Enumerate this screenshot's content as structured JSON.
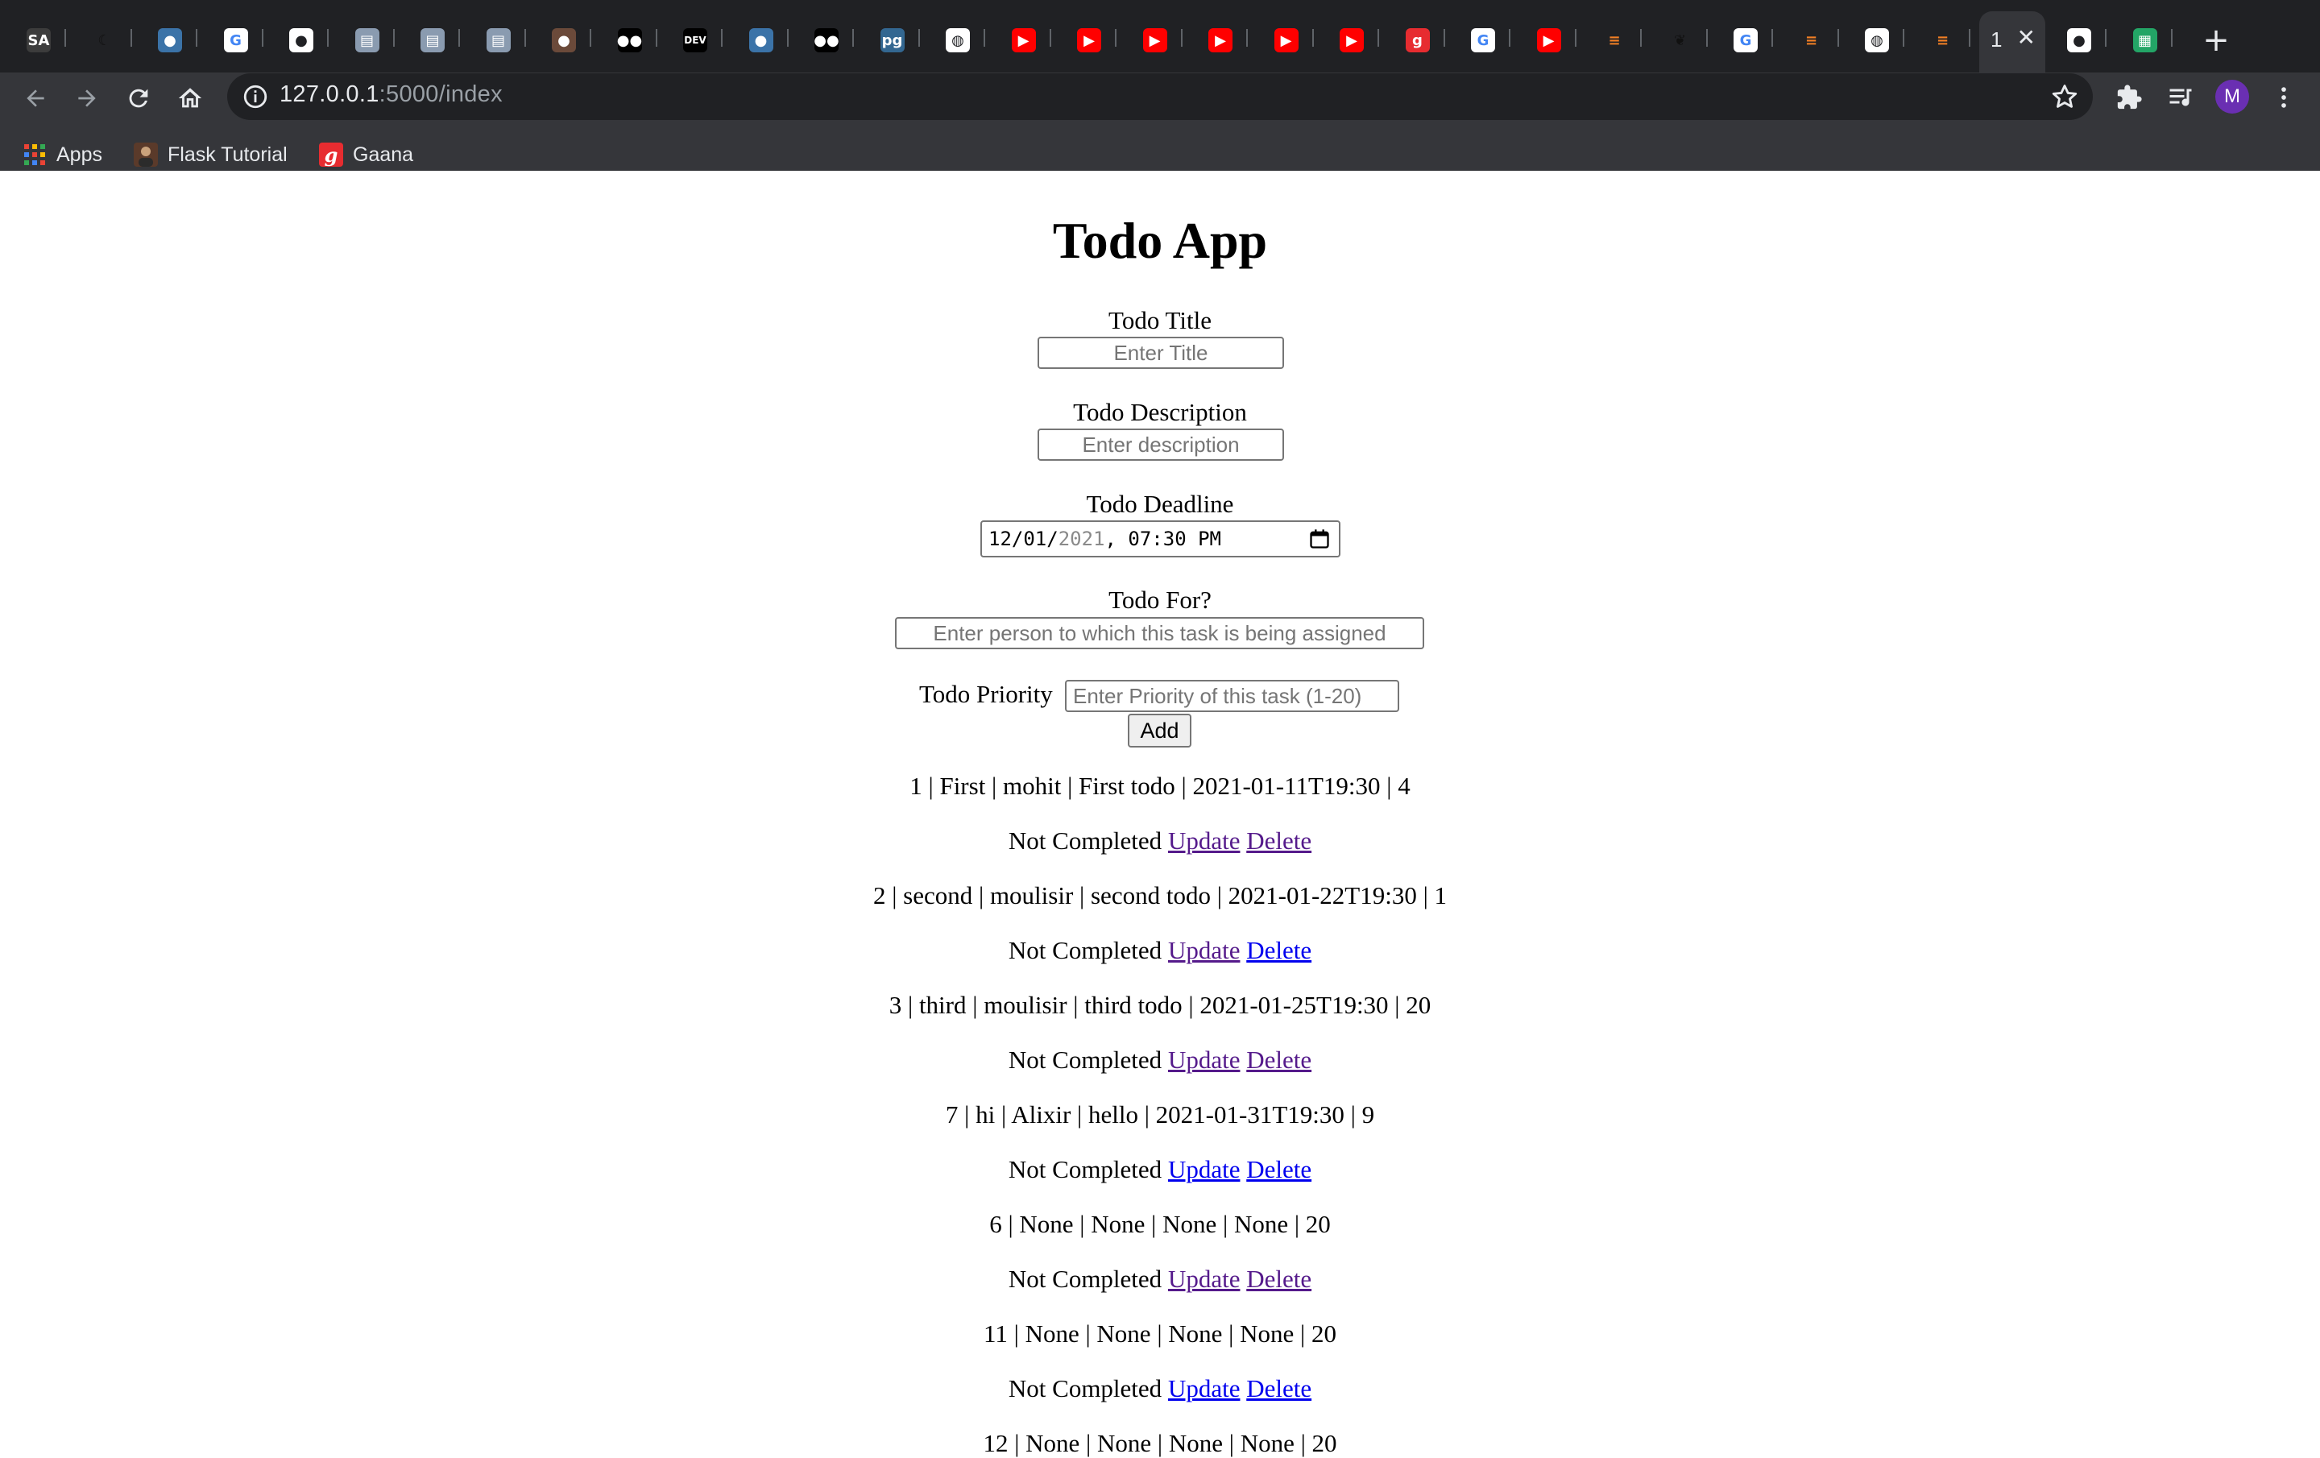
{
  "browser": {
    "tabs": [
      {
        "icon": "sa-icon"
      },
      {
        "icon": "moon-icon"
      },
      {
        "icon": "python-icon"
      },
      {
        "icon": "google-icon"
      },
      {
        "icon": "github-icon"
      },
      {
        "icon": "book-icon"
      },
      {
        "icon": "book-icon"
      },
      {
        "icon": "book-icon"
      },
      {
        "icon": "avatar-icon"
      },
      {
        "icon": "medium-icon"
      },
      {
        "icon": "dev-icon"
      },
      {
        "icon": "python-icon"
      },
      {
        "icon": "medium-icon"
      },
      {
        "icon": "pg-icon"
      },
      {
        "icon": "globe-icon"
      },
      {
        "icon": "youtube-icon"
      },
      {
        "icon": "youtube-icon"
      },
      {
        "icon": "youtube-icon"
      },
      {
        "icon": "youtube-icon"
      },
      {
        "icon": "youtube-icon"
      },
      {
        "icon": "youtube-icon"
      },
      {
        "icon": "gaana-icon"
      },
      {
        "icon": "google-icon"
      },
      {
        "icon": "youtube-icon"
      },
      {
        "icon": "stackoverflow-icon"
      },
      {
        "icon": "leaf-icon"
      },
      {
        "icon": "google-icon"
      },
      {
        "icon": "stackoverflow-icon"
      },
      {
        "icon": "globe-icon"
      },
      {
        "icon": "stackoverflow-icon"
      }
    ],
    "active_tab": {
      "label": "1",
      "close": "✕"
    },
    "after_tabs": [
      {
        "icon": "github-icon"
      },
      {
        "icon": "sheets-icon"
      }
    ],
    "new_tab": "+",
    "url_host": "127.0.0.1",
    "url_rest": ":5000/index",
    "avatar_letter": "M",
    "bookmarks": [
      {
        "label": "Apps",
        "icon": "apps-grid-icon"
      },
      {
        "label": "Flask Tutorial",
        "icon": "avatar-icon"
      },
      {
        "label": "Gaana",
        "icon": "gaana-icon"
      }
    ],
    "colors": {
      "frame": "#202124",
      "toolbar": "#35363a",
      "text": "#e8eaed"
    }
  },
  "page": {
    "title": "Todo App",
    "form": {
      "title_label": "Todo Title",
      "title_placeholder": "Enter Title",
      "desc_label": "Todo Description",
      "desc_placeholder": "Enter description",
      "deadline_label": "Todo Deadline",
      "deadline_date": "12/01/",
      "deadline_year": "2021",
      "deadline_time": ", 07:30 PM",
      "for_label": "Todo For?",
      "for_placeholder": "Enter person to which this task is being assigned",
      "priority_label": "Todo Priority",
      "priority_placeholder": "Enter Priority of this task (1-20)",
      "add_label": "Add"
    },
    "todos": [
      {
        "text": "1 | First | mohit | First todo | 2021-01-11T19:30 | 4",
        "status": "Not Completed",
        "update": "Update",
        "delete": "Delete",
        "update_visited": true,
        "delete_visited": true
      },
      {
        "text": "2 | second | moulisir | second todo | 2021-01-22T19:30 | 1",
        "status": "Not Completed",
        "update": "Update",
        "delete": "Delete",
        "update_visited": true,
        "delete_visited": false
      },
      {
        "text": "3 | third | moulisir | third todo | 2021-01-25T19:30 | 20",
        "status": "Not Completed",
        "update": "Update",
        "delete": "Delete",
        "update_visited": true,
        "delete_visited": true
      },
      {
        "text": "7 | hi | Alixir | hello | 2021-01-31T19:30 | 9",
        "status": "Not Completed",
        "update": "Update",
        "delete": "Delete",
        "update_visited": false,
        "delete_visited": false
      },
      {
        "text": "6 | None | None | None | None | 20",
        "status": "Not Completed",
        "update": "Update",
        "delete": "Delete",
        "update_visited": true,
        "delete_visited": true
      },
      {
        "text": "11 | None | None | None | None | 20",
        "status": "Not Completed",
        "update": "Update",
        "delete": "Delete",
        "update_visited": false,
        "delete_visited": false
      },
      {
        "text": "12 | None | None | None | None | 20",
        "status": "",
        "update": "",
        "delete": "",
        "update_visited": false,
        "delete_visited": false
      }
    ],
    "link_colors": {
      "visited": "#551a8b",
      "unvisited": "#0000ee"
    }
  }
}
